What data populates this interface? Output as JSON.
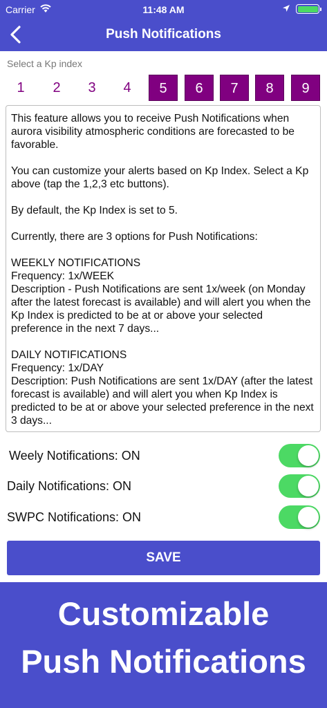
{
  "status_bar": {
    "carrier": "Carrier",
    "time": "11:48 AM",
    "battery_color": "#4cd964"
  },
  "nav": {
    "title": "Push Notifications",
    "back_icon": "chevron-left-icon"
  },
  "kp": {
    "label": "Select a Kp index",
    "selected_from": 5,
    "buttons": [
      "1",
      "2",
      "3",
      "4",
      "5",
      "6",
      "7",
      "8",
      "9"
    ]
  },
  "description": {
    "p1": "This feature allows you to receive Push Notifications when aurora visibility atmospheric conditions are forecasted to be favorable.",
    "p2": "You can customize your alerts based on Kp Index. Select a Kp above (tap the 1,2,3 etc buttons).",
    "p3": "By default, the Kp Index is set to 5.",
    "p4": "Currently, there are 3 options for Push Notifications:",
    "weekly_heading": "WEEKLY NOTIFICATIONS",
    "weekly_frequency": "Frequency: 1x/WEEK",
    "weekly_description": "Description - Push Notifications are sent 1x/week (on Monday after the latest forecast is available) and will alert you when the Kp Index is predicted to be at or above your selected preference in the next 7 days...",
    "daily_heading": "DAILY NOTIFICATIONS",
    "daily_frequency": "Frequency: 1x/DAY",
    "daily_description": "Description: Push Notifications are sent 1x/DAY (after the latest forecast is available) and will alert you when Kp Index is predicted to be at or above your selected preference in the next 3 days..."
  },
  "toggles": {
    "weekly": {
      "label": "Weely Notifications: ON",
      "on": true
    },
    "daily": {
      "label": "Daily Notifications: ON",
      "on": true
    },
    "swpc": {
      "label": "SWPC Notifications: ON",
      "on": true
    }
  },
  "save_label": "SAVE",
  "promo": {
    "line1": "Customizable",
    "line2": "Push Notifications"
  },
  "colors": {
    "brand": "#4a4ecb",
    "kp_accent": "#800080",
    "toggle_on": "#4cd964"
  }
}
